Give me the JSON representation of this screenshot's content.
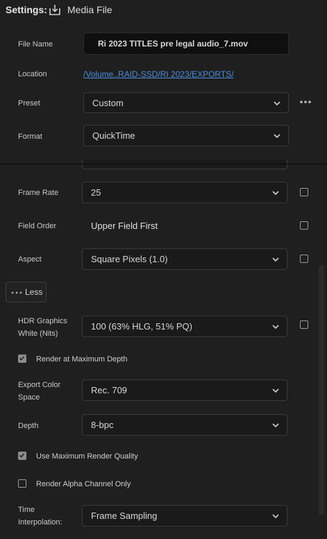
{
  "header": {
    "settings_label": "Settings:",
    "media_file_label": "Media File"
  },
  "file_name": {
    "label": "File Name",
    "value": "Ri 2023 TITLES pre legal audio_7.mov"
  },
  "location": {
    "label": "Location",
    "value": "/Volume..RAID-SSD/RI 2023/EXPORTS/"
  },
  "preset": {
    "label": "Preset",
    "value": "Custom"
  },
  "format": {
    "label": "Format",
    "value": "QuickTime"
  },
  "frame_rate": {
    "label": "Frame Rate",
    "value": "25"
  },
  "field_order": {
    "label": "Field Order",
    "value": "Upper Field First"
  },
  "aspect": {
    "label": "Aspect",
    "value": "Square Pixels (1.0)"
  },
  "less_button": {
    "label": "Less"
  },
  "hdr": {
    "label_line1": "HDR Graphics",
    "label_line2": "White (Nits)",
    "value": "100 (63% HLG, 51% PQ)"
  },
  "render_max_depth": {
    "label": "Render at Maximum Depth",
    "checked": true
  },
  "export_color_space": {
    "label_line1": "Export Color",
    "label_line2": "Space",
    "value": "Rec. 709"
  },
  "depth": {
    "label": "Depth",
    "value": "8-bpc"
  },
  "max_render_quality": {
    "label": "Use Maximum Render Quality",
    "checked": true
  },
  "render_alpha": {
    "label": "Render Alpha Channel Only",
    "checked": false
  },
  "time_interpolation": {
    "label_line1": "Time",
    "label_line2": "Interpolation:",
    "value": "Frame Sampling"
  },
  "colors": {
    "background": "#1f1f1f",
    "link": "#4a8fe0",
    "field_bg": "#1a1a1a",
    "checkbox_checked": "#8c8c8c"
  }
}
